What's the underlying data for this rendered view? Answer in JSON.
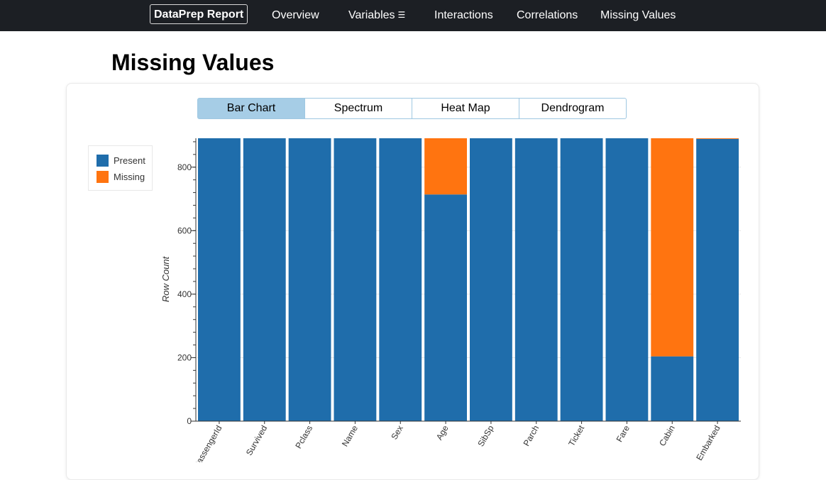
{
  "nav": {
    "brand": "DataPrep Report",
    "items": [
      {
        "label": "Overview"
      },
      {
        "label": "Variables",
        "icon": "menu-icon"
      },
      {
        "label": "Interactions"
      },
      {
        "label": "Correlations"
      },
      {
        "label": "Missing Values"
      }
    ]
  },
  "page": {
    "title": "Missing Values"
  },
  "tabs": [
    {
      "label": "Bar Chart",
      "active": true
    },
    {
      "label": "Spectrum",
      "active": false
    },
    {
      "label": "Heat Map",
      "active": false
    },
    {
      "label": "Dendrogram",
      "active": false
    }
  ],
  "colors": {
    "present": "#1f6dab",
    "missing": "#ff7410",
    "active_tab": "#a6cde6",
    "navbar": "#1c1f24"
  },
  "chart_data": {
    "type": "bar",
    "stacked": true,
    "categories": [
      "PassengerId",
      "Survived",
      "Pclass",
      "Name",
      "Sex",
      "Age",
      "SibSp",
      "Parch",
      "Ticket",
      "Fare",
      "Cabin",
      "Embarked"
    ],
    "series": [
      {
        "name": "Present",
        "color": "#1f6dab",
        "values": [
          891,
          891,
          891,
          891,
          891,
          714,
          891,
          891,
          891,
          891,
          204,
          889
        ]
      },
      {
        "name": "Missing",
        "color": "#ff7410",
        "values": [
          0,
          0,
          0,
          0,
          0,
          177,
          0,
          0,
          0,
          0,
          687,
          2
        ]
      }
    ],
    "ylabel": "Row Count",
    "xlabel": "",
    "ylim": [
      0,
      891
    ],
    "yticks": [
      0,
      200,
      400,
      600,
      800
    ],
    "legend_position": "left",
    "grid": "horizontal"
  }
}
